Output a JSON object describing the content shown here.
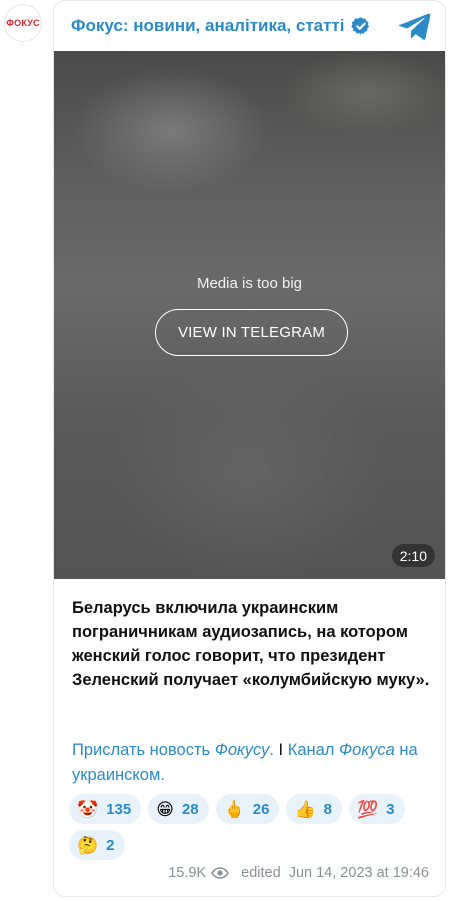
{
  "avatar": {
    "logo_text": "ФОКУС"
  },
  "header": {
    "title": "Фокус: новини, аналітика, статті",
    "verified_icon": "verified-badge-icon",
    "telegram_icon": "telegram-icon"
  },
  "media": {
    "message": "Media is too big",
    "button_label": "VIEW IN TELEGRAM",
    "duration": "2:10"
  },
  "post": {
    "text": "Беларусь включила украинским пограничникам аудиозапись, на котором женский голос говорит, что президент Зеленский получает «колумбийскую муку».",
    "link1_prefix": "Прислать новость ",
    "link1_italic": "Фокусу",
    "link1_suffix": ".",
    "separator": " I ",
    "link2_prefix": "Канал ",
    "link2_italic": "Фокуса",
    "link2_suffix": " на украинском."
  },
  "reactions": [
    {
      "emoji": "🤡",
      "count": "135"
    },
    {
      "emoji": "😁",
      "count": "28"
    },
    {
      "emoji": "🖕",
      "count": "26"
    },
    {
      "emoji": "👍",
      "count": "8"
    },
    {
      "emoji": "💯",
      "count": "3"
    },
    {
      "emoji": "🤔",
      "count": "2"
    }
  ],
  "footer": {
    "views": "15.9K",
    "views_icon": "eye-icon",
    "edited": "edited  Jun 14, 2023 at 19:46"
  },
  "colors": {
    "accent": "#2a8bc7",
    "logo_red": "#e0232b",
    "reaction_bg": "#e7f2fb"
  }
}
